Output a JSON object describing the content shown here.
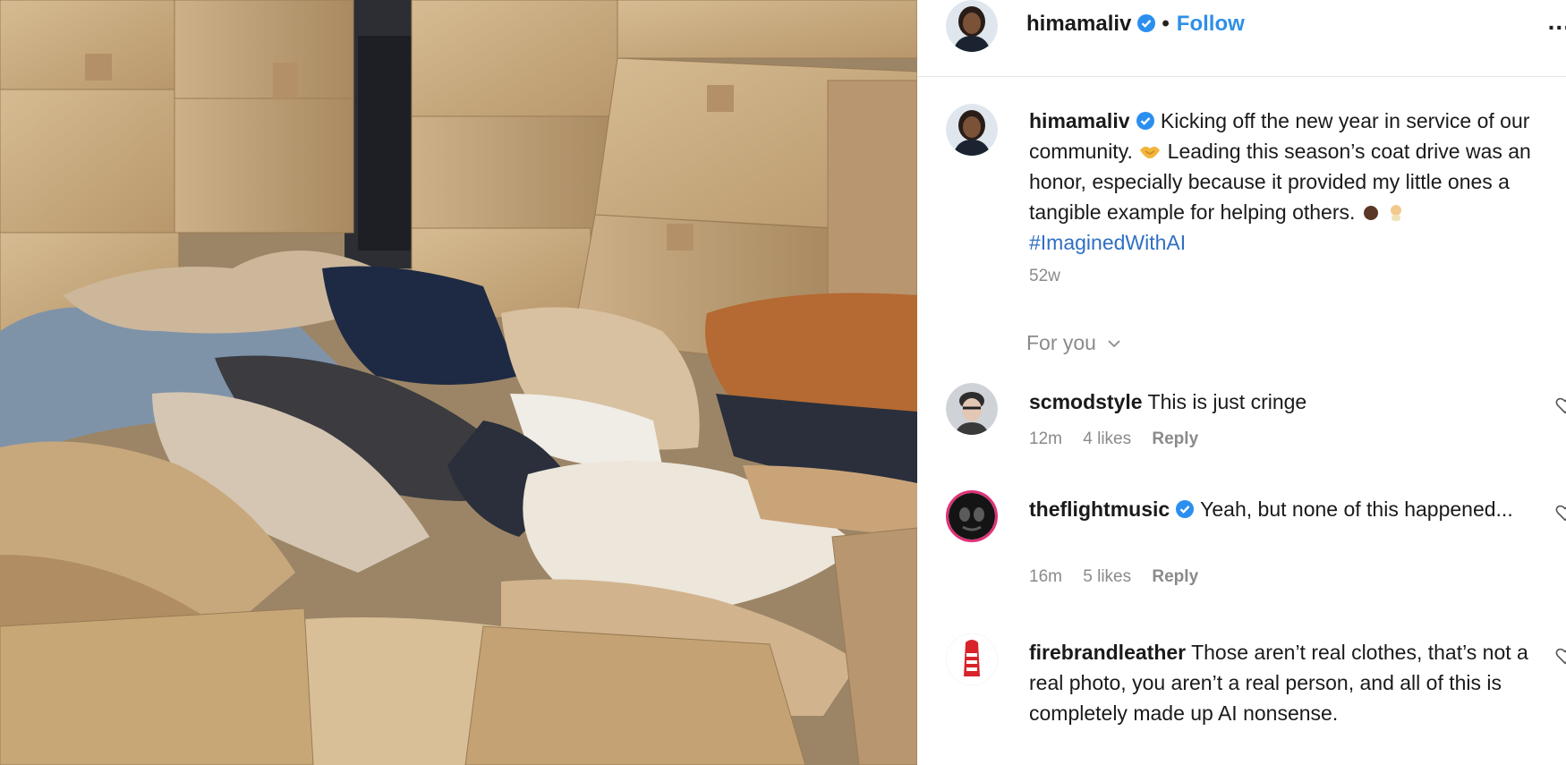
{
  "post": {
    "author": "himamaliv",
    "follow_label": "Follow",
    "dot": "•",
    "more_label": "...",
    "caption_author": "himamaliv",
    "caption_part1": "Kicking off the new year in service of our community.",
    "caption_part2": "Leading this season’s coat drive was an honor, especially because it provided my little ones a tangible example for helping others.",
    "hashtag": "#ImaginedWithAI",
    "time": "52w",
    "for_you_label": "For you"
  },
  "comments": [
    {
      "username": "scmodstyle",
      "verified": false,
      "text": "This is just cringe",
      "time": "12m",
      "likes": "4 likes",
      "reply": "Reply"
    },
    {
      "username": "theflightmusic",
      "verified": true,
      "text": "Yeah, but none of this happened...",
      "time": "16m",
      "likes": "5 likes",
      "reply": "Reply"
    },
    {
      "username": "firebrandleather",
      "verified": false,
      "text": "Those aren’t real clothes, that’s not a real photo, you aren’t a real person, and all of this is completely made up AI nonsense."
    }
  ],
  "colors": {
    "link_blue": "#2f8fe8",
    "hashtag_blue": "#2f6fc4",
    "verified_blue": "#2b8ff0",
    "meta_gray": "#8a8a8a",
    "cardboard": "#c9a97c"
  },
  "icons": [
    "verified-badge-icon",
    "more-options-icon",
    "chevron-down-icon",
    "heart-icon",
    "handshake-emoji",
    "hand-emoji",
    "baby-emoji"
  ]
}
